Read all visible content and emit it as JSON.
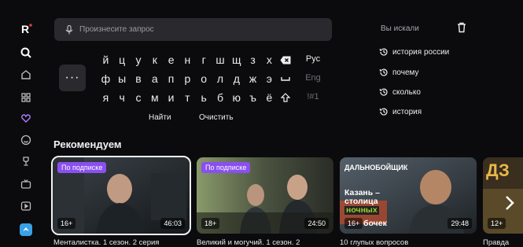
{
  "sidebar": {
    "logo": "R",
    "items": [
      "logo-icon",
      "search-icon",
      "home-icon",
      "grid-icon",
      "heart-icon",
      "smile-icon",
      "trophy-icon",
      "tv-icon",
      "play-icon",
      "avatar-icon"
    ]
  },
  "search": {
    "placeholder": "Произнесите запрос"
  },
  "keyboard": {
    "more_label": "···",
    "row1": [
      "й",
      "ц",
      "у",
      "к",
      "е",
      "н",
      "г",
      "ш",
      "щ",
      "з",
      "х"
    ],
    "row2": [
      "ф",
      "ы",
      "в",
      "а",
      "п",
      "р",
      "о",
      "л",
      "д",
      "ж",
      "э"
    ],
    "row3": [
      "я",
      "ч",
      "с",
      "м",
      "и",
      "т",
      "ь",
      "б",
      "ю",
      "ъ",
      "ё"
    ],
    "lang_ru": "Рус",
    "lang_en": "Eng",
    "symbols": "!#1",
    "find": "Найти",
    "clear": "Очистить"
  },
  "history": {
    "title": "Вы искали",
    "items": [
      "история россии",
      "почему",
      "сколько",
      "история"
    ]
  },
  "recommendations": {
    "title": "Рекомендуем",
    "cards": [
      {
        "badge": "По подписке",
        "age": "16+",
        "duration": "46:03",
        "caption": "Менталистка. 1 сезон. 2 серия"
      },
      {
        "badge": "По подписке",
        "age": "18+",
        "duration": "24:50",
        "caption": "Великий и могучий. 1 сезон. 2"
      },
      {
        "top_label": "ДАЛЬНОБОЙЩИК",
        "art_text": [
          "Казань –",
          "столица",
          "ночных",
          "бочек"
        ],
        "age": "16+",
        "duration": "29:48",
        "caption": "10 глупых вопросов"
      },
      {
        "art_text": [
          "ДЗ"
        ],
        "age": "12+",
        "caption": "Правда"
      }
    ]
  },
  "colors": {
    "accent": "#8a4ff0",
    "bg": "#0b0b0d",
    "logo_dot": "#e03a3a"
  }
}
